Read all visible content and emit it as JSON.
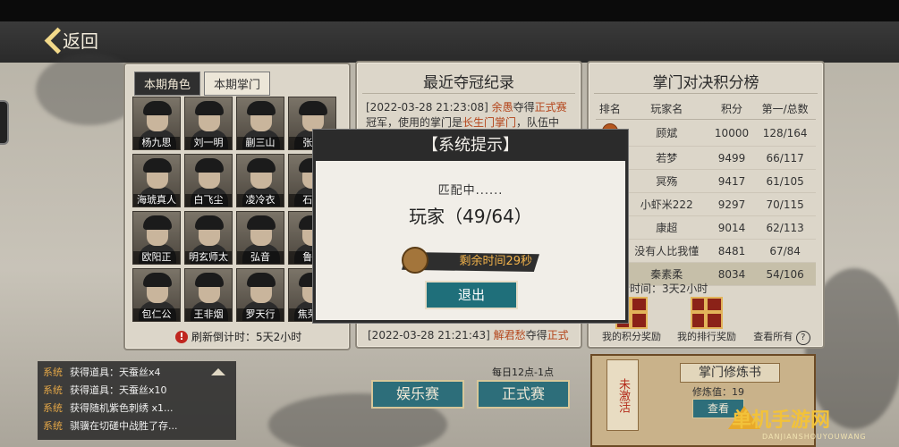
{
  "header": {
    "back_label": "返回"
  },
  "left_panel": {
    "tabs": [
      {
        "label": "本期角色",
        "active": true
      },
      {
        "label": "本期掌门",
        "active": false
      }
    ],
    "characters": [
      "杨九思",
      "刘一明",
      "蒯三山",
      "张...",
      "海琥真人",
      "白飞尘",
      "凌冷衣",
      "石...",
      "欧阳正",
      "明玄师太",
      "弘音",
      "鲁...",
      "包仁公",
      "王非烟",
      "罗天行",
      "焦荣..."
    ],
    "refresh_text": "刷新倒计时：5天2小时"
  },
  "middle_panel": {
    "title": "最近夺冠纪录",
    "record_top_line1": "[2022-03-28 21:23:08] ",
    "record_top_name": "余愚",
    "record_top_mid": "夺得",
    "record_top_mode": "正式赛",
    "record_top_line2a": "冠军，使用的掌门是",
    "record_top_sect": "长生门掌门",
    "record_top_line2b": "，队伍中",
    "record_bottom_time": "[2022-03-28 21:21:43] ",
    "record_bottom_name": "解君愁",
    "record_bottom_mid": "夺得",
    "record_bottom_mode": "正式"
  },
  "right_panel": {
    "title": "掌门对决积分榜",
    "headers": [
      "排名",
      "玩家名",
      "积分",
      "第一/总数"
    ],
    "rows": [
      {
        "name": "顾斌",
        "score": "10000",
        "ratio": "128/164"
      },
      {
        "name": "若梦",
        "score": "9499",
        "ratio": "66/117"
      },
      {
        "name": "冥殇",
        "score": "9417",
        "ratio": "61/105"
      },
      {
        "name": "小虾米222",
        "score": "9297",
        "ratio": "70/115"
      },
      {
        "name": "康超",
        "score": "9014",
        "ratio": "62/113"
      },
      {
        "name": "没有人比我懂",
        "score": "8481",
        "ratio": "67/84"
      },
      {
        "name": "秦素柔",
        "score": "8034",
        "ratio": "54/106"
      }
    ],
    "remain_text": "余剩余时间：3天2小时",
    "reward1": "我的积分奖励",
    "reward2": "我的排行奖励",
    "view_all": "查看所有"
  },
  "chat": [
    {
      "tag": "系统",
      "text": "获得道具：天蚕丝x4"
    },
    {
      "tag": "系统",
      "text": "获得道具：天蚕丝x10"
    },
    {
      "tag": "系统",
      "text": "获得随机紫色刺绣 x1..."
    },
    {
      "tag": "系统",
      "text": "骐骥在切磋中战胜了存..."
    }
  ],
  "bottom": {
    "daily_text": "每日12点-1点",
    "btn_fun": "娱乐赛",
    "btn_formal": "正式赛"
  },
  "book": {
    "spine": "未激活",
    "title": "掌门修炼书",
    "value": "修炼值：19",
    "view": "查看"
  },
  "modal": {
    "title": "【系统提示】",
    "matching": "匹配中......",
    "players": "玩家（49/64）",
    "timer": "剩余时间29秒",
    "exit": "退出"
  },
  "watermark": {
    "main": "单机手游网",
    "sub": "DANJIANSHOUYOUWANG"
  }
}
